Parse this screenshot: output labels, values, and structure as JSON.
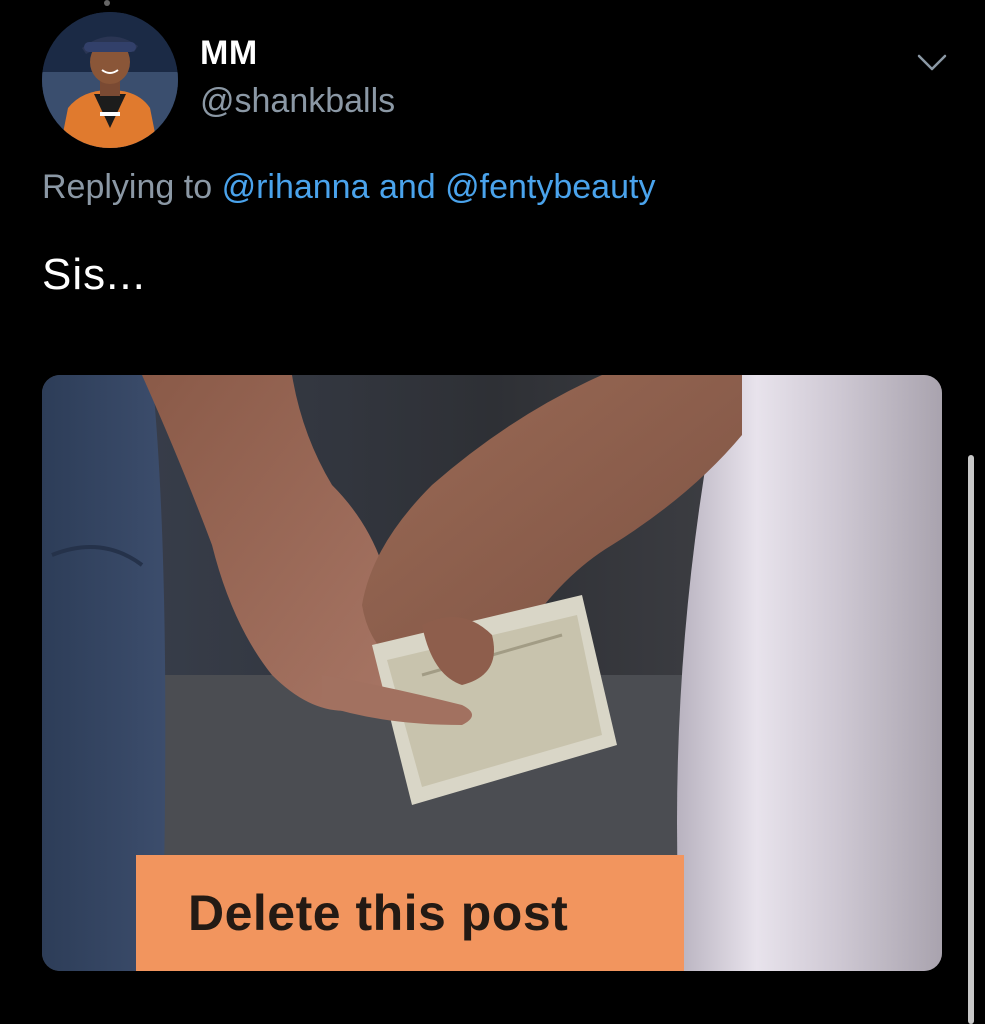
{
  "tweet": {
    "display_name": "MM",
    "handle": "@shankballs",
    "replying_prefix": "Replying to",
    "mention_1": "@rihanna",
    "replying_and": "and",
    "mention_2": "@fentybeauty",
    "text": "Sis...",
    "media": {
      "caption": "Delete this post"
    }
  },
  "icons": {
    "menu": "chevron-down-icon"
  },
  "colors": {
    "background": "#000000",
    "secondary_text": "#8b98a5",
    "mention": "#4aa3ec",
    "caption_bg": "#f2955e"
  }
}
